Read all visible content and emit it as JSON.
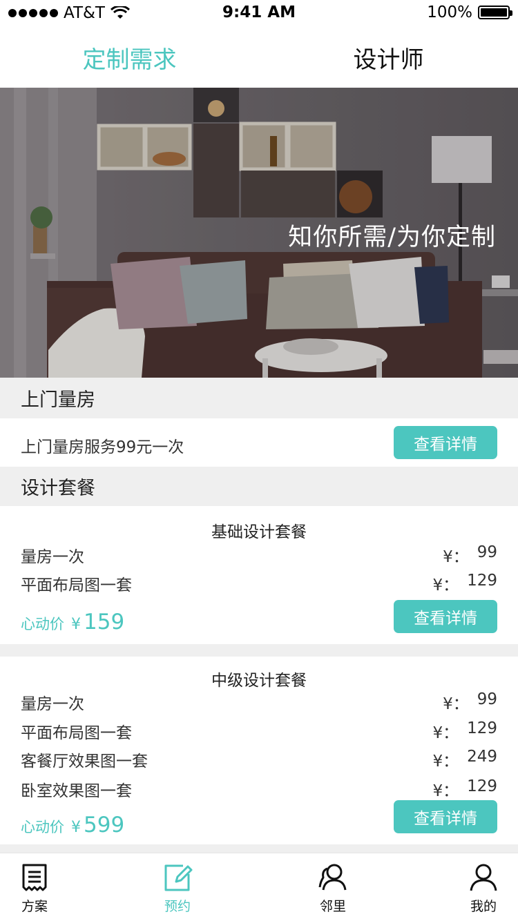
{
  "status_bar": {
    "carrier": "AT&T",
    "time": "9:41 AM",
    "battery": "100%"
  },
  "top_tabs": [
    {
      "label": "定制需求",
      "active": true
    },
    {
      "label": "设计师",
      "active": false
    }
  ],
  "hero": {
    "slogan": "知你所需/为你定制"
  },
  "measure_section": {
    "title": "上门量房",
    "service_text": "上门量房服务99元一次",
    "button": "查看详情"
  },
  "design_section": {
    "title": "设计套餐"
  },
  "packages": [
    {
      "title": "基础设计套餐",
      "items": [
        {
          "name": "量房一次",
          "yen": "¥：",
          "price": "99"
        },
        {
          "name": "平面布局图一套",
          "yen": "¥：",
          "price": "129"
        }
      ],
      "deal_label": "心动价",
      "deal_yen": "¥",
      "deal_price": "159",
      "button": "查看详情"
    },
    {
      "title": "中级设计套餐",
      "items": [
        {
          "name": "量房一次",
          "yen": "¥：",
          "price": "99"
        },
        {
          "name": "平面布局图一套",
          "yen": "¥：",
          "price": "129"
        },
        {
          "name": "客餐厅效果图一套",
          "yen": "¥：",
          "price": "249"
        },
        {
          "name": "卧室效果图一套",
          "yen": "¥：",
          "price": "129"
        }
      ],
      "deal_label": "心动价",
      "deal_yen": "¥",
      "deal_price": "599",
      "button": "查看详情"
    }
  ],
  "tab_bar": [
    {
      "label": "方案",
      "icon": "document-icon",
      "active": false
    },
    {
      "label": "预约",
      "icon": "edit-icon",
      "active": true
    },
    {
      "label": "邻里",
      "icon": "people-icon",
      "active": false
    },
    {
      "label": "我的",
      "icon": "person-icon",
      "active": false
    }
  ],
  "colors": {
    "accent": "#4cc6bf",
    "section_bg": "#efefef"
  }
}
